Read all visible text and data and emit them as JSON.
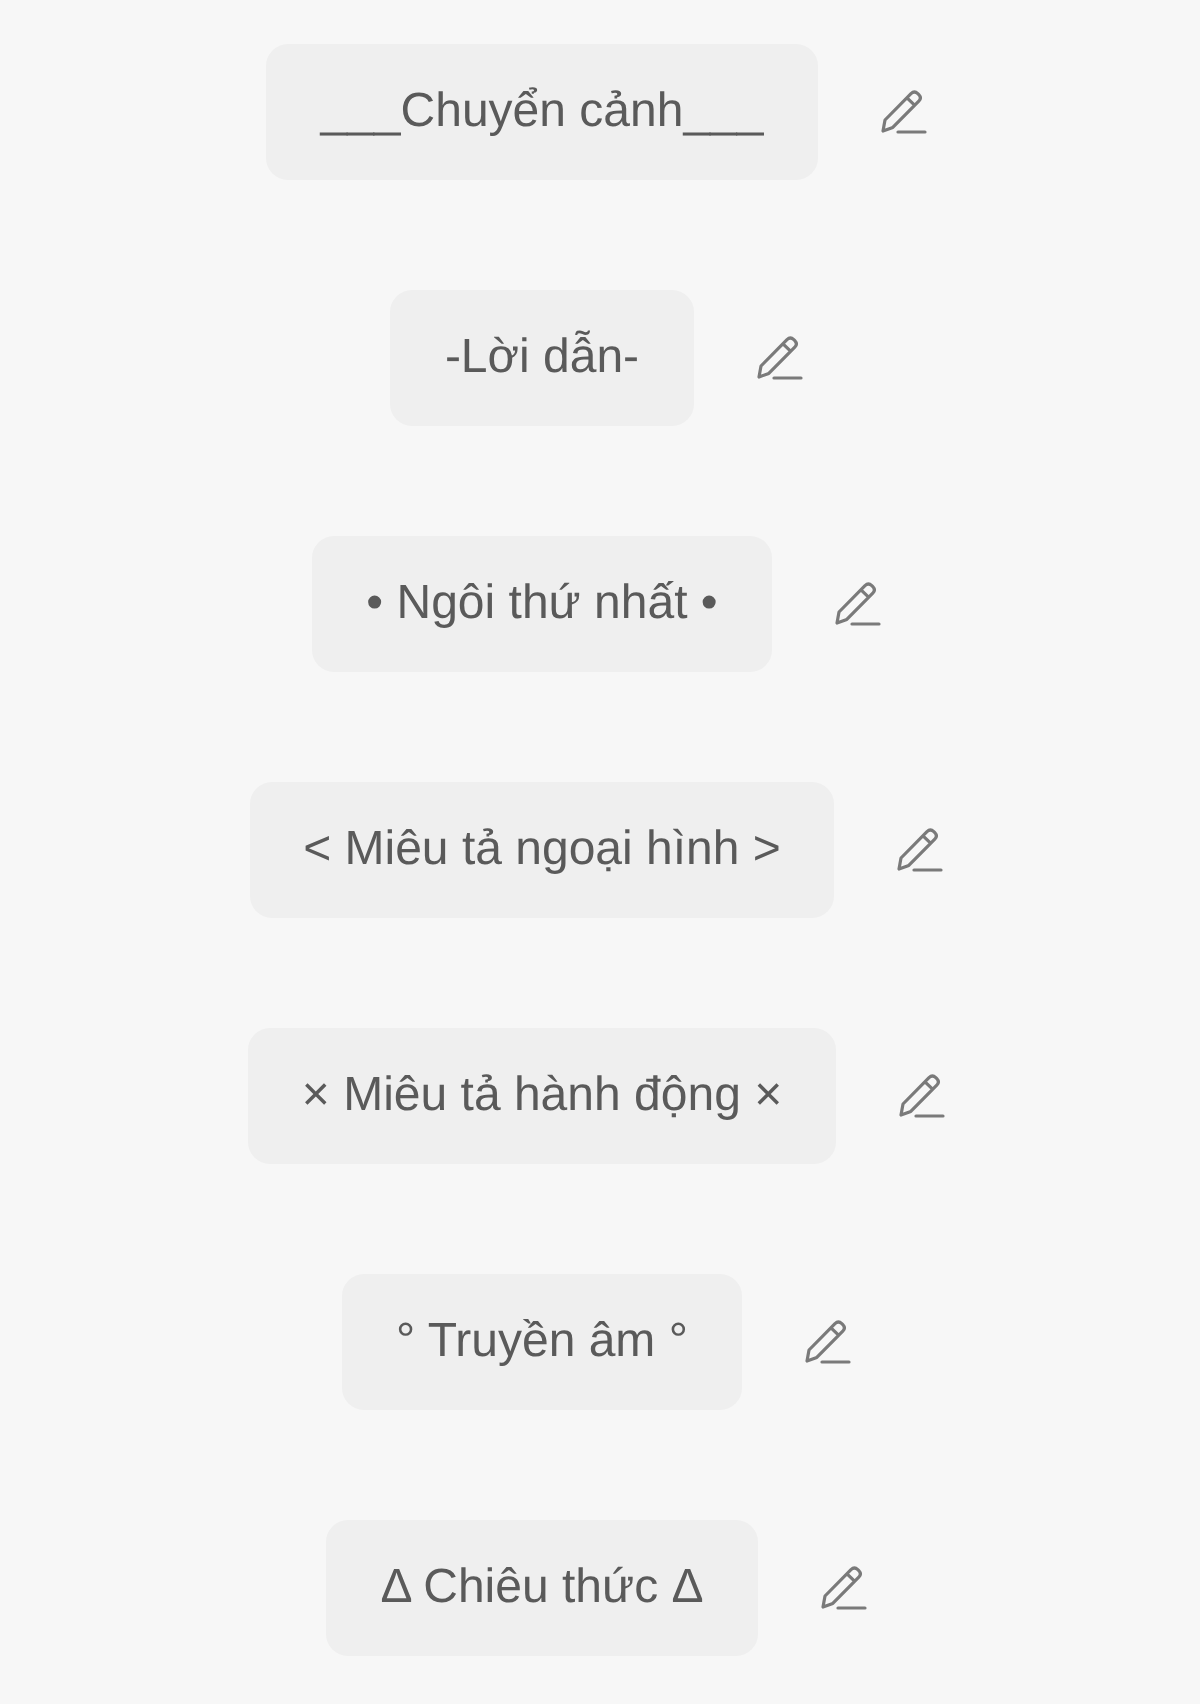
{
  "items": [
    {
      "label": "___Chuyển cảnh___"
    },
    {
      "label": "-Lời dẫn-"
    },
    {
      "label": "• Ngôi thứ nhất •"
    },
    {
      "label": "< Miêu tả ngoại hình >"
    },
    {
      "label": "× Miêu tả hành động ×"
    },
    {
      "label": "° Truyền âm °"
    },
    {
      "label": "Δ Chiêu thức Δ"
    }
  ]
}
